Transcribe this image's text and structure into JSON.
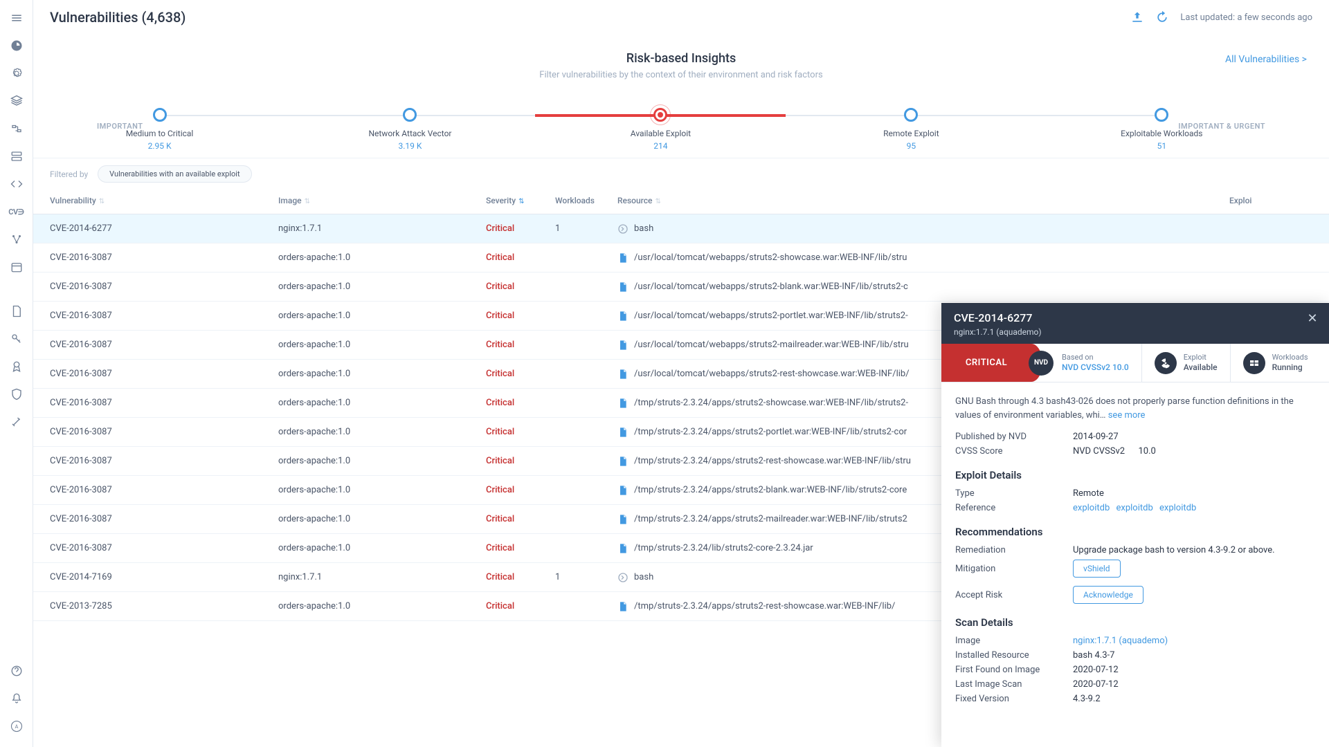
{
  "header": {
    "title": "Vulnerabilities (4,638)",
    "last_updated": "Last updated: a few seconds ago"
  },
  "insights": {
    "title": "Risk-based Insights",
    "subtitle": "Filter vulnerabilities by the context of their environment and risk factors",
    "all_link": "All Vulnerabilities >",
    "left_label": "IMPORTANT",
    "right_label": "IMPORTANT & URGENT",
    "steps": [
      {
        "label": "Medium to Critical",
        "count": "2.95 K"
      },
      {
        "label": "Network Attack Vector",
        "count": "3.19 K"
      },
      {
        "label": "Available Exploit",
        "count": "214"
      },
      {
        "label": "Remote Exploit",
        "count": "95"
      },
      {
        "label": "Exploitable Workloads",
        "count": "51"
      }
    ],
    "active_step": 2
  },
  "filter": {
    "label": "Filtered by",
    "chip": "Vulnerabilities with an available exploit"
  },
  "table": {
    "headers": {
      "vulnerability": "Vulnerability",
      "image": "Image",
      "severity": "Severity",
      "workloads": "Workloads",
      "resource": "Resource",
      "exploit": "Exploi"
    },
    "rows": [
      {
        "vuln": "CVE-2014-6277",
        "image": "nginx:1.7.1",
        "severity": "Critical",
        "workloads": "1",
        "resource": "bash",
        "res_type": "shell",
        "selected": true
      },
      {
        "vuln": "CVE-2016-3087",
        "image": "orders-apache:1.0",
        "severity": "Critical",
        "workloads": "",
        "resource": "/usr/local/tomcat/webapps/struts2-showcase.war:WEB-INF/lib/stru",
        "res_type": "file"
      },
      {
        "vuln": "CVE-2016-3087",
        "image": "orders-apache:1.0",
        "severity": "Critical",
        "workloads": "",
        "resource": "/usr/local/tomcat/webapps/struts2-blank.war:WEB-INF/lib/struts2-c",
        "res_type": "file"
      },
      {
        "vuln": "CVE-2016-3087",
        "image": "orders-apache:1.0",
        "severity": "Critical",
        "workloads": "",
        "resource": "/usr/local/tomcat/webapps/struts2-portlet.war:WEB-INF/lib/struts2-",
        "res_type": "file"
      },
      {
        "vuln": "CVE-2016-3087",
        "image": "orders-apache:1.0",
        "severity": "Critical",
        "workloads": "",
        "resource": "/usr/local/tomcat/webapps/struts2-mailreader.war:WEB-INF/lib/stru",
        "res_type": "file"
      },
      {
        "vuln": "CVE-2016-3087",
        "image": "orders-apache:1.0",
        "severity": "Critical",
        "workloads": "",
        "resource": "/usr/local/tomcat/webapps/struts2-rest-showcase.war:WEB-INF/lib/",
        "res_type": "file"
      },
      {
        "vuln": "CVE-2016-3087",
        "image": "orders-apache:1.0",
        "severity": "Critical",
        "workloads": "",
        "resource": "/tmp/struts-2.3.24/apps/struts2-showcase.war:WEB-INF/lib/struts2-",
        "res_type": "file"
      },
      {
        "vuln": "CVE-2016-3087",
        "image": "orders-apache:1.0",
        "severity": "Critical",
        "workloads": "",
        "resource": "/tmp/struts-2.3.24/apps/struts2-portlet.war:WEB-INF/lib/struts2-cor",
        "res_type": "file"
      },
      {
        "vuln": "CVE-2016-3087",
        "image": "orders-apache:1.0",
        "severity": "Critical",
        "workloads": "",
        "resource": "/tmp/struts-2.3.24/apps/struts2-rest-showcase.war:WEB-INF/lib/stru",
        "res_type": "file"
      },
      {
        "vuln": "CVE-2016-3087",
        "image": "orders-apache:1.0",
        "severity": "Critical",
        "workloads": "",
        "resource": "/tmp/struts-2.3.24/apps/struts2-blank.war:WEB-INF/lib/struts2-core",
        "res_type": "file"
      },
      {
        "vuln": "CVE-2016-3087",
        "image": "orders-apache:1.0",
        "severity": "Critical",
        "workloads": "",
        "resource": "/tmp/struts-2.3.24/apps/struts2-mailreader.war:WEB-INF/lib/struts2",
        "res_type": "file"
      },
      {
        "vuln": "CVE-2016-3087",
        "image": "orders-apache:1.0",
        "severity": "Critical",
        "workloads": "",
        "resource": "/tmp/struts-2.3.24/lib/struts2-core-2.3.24.jar",
        "res_type": "file"
      },
      {
        "vuln": "CVE-2014-7169",
        "image": "nginx:1.7.1",
        "severity": "Critical",
        "workloads": "1",
        "resource": "bash",
        "res_type": "shell"
      },
      {
        "vuln": "CVE-2013-7285",
        "image": "orders-apache:1.0",
        "severity": "Critical",
        "workloads": "",
        "resource": "/tmp/struts-2.3.24/apps/struts2-rest-showcase.war:WEB-INF/lib/",
        "res_type": "file"
      }
    ]
  },
  "detail": {
    "title": "CVE-2014-6277",
    "subtitle": "nginx:1.7.1 (aquademo)",
    "severity": "CRITICAL",
    "nvd_badge": "NVD",
    "based_on_label": "Based on",
    "based_on_value": "NVD CVSSv2 10.0",
    "exploit_label": "Exploit",
    "exploit_value": "Available",
    "workloads_label": "Workloads",
    "workloads_value": "Running",
    "description": "GNU Bash through 4.3 bash43-026 does not properly parse function definitions in the values of environment variables, whi…",
    "see_more": "see more",
    "published_key": "Published by NVD",
    "published_val": "2014-09-27",
    "cvss_key": "CVSS Score",
    "cvss_link": "NVD CVSSv2",
    "cvss_score": "10.0",
    "exploit_details_title": "Exploit Details",
    "type_key": "Type",
    "type_val": "Remote",
    "reference_key": "Reference",
    "reference_vals": [
      "exploitdb",
      "exploitdb",
      "exploitdb"
    ],
    "recommendations_title": "Recommendations",
    "remediation_key": "Remediation",
    "remediation_val": "Upgrade package bash to version 4.3-9.2 or above.",
    "mitigation_key": "Mitigation",
    "mitigation_btn": "vShield",
    "accept_risk_key": "Accept Risk",
    "accept_risk_btn": "Acknowledge",
    "scan_details_title": "Scan Details",
    "image_key": "Image",
    "image_val": "nginx:1.7.1 (aquademo)",
    "installed_key": "Installed Resource",
    "installed_val": "bash 4.3-7",
    "first_found_key": "First Found on Image",
    "first_found_val": "2020-07-12",
    "last_scan_key": "Last Image Scan",
    "last_scan_val": "2020-07-12",
    "fixed_key": "Fixed Version",
    "fixed_val": "4.3-9.2"
  }
}
